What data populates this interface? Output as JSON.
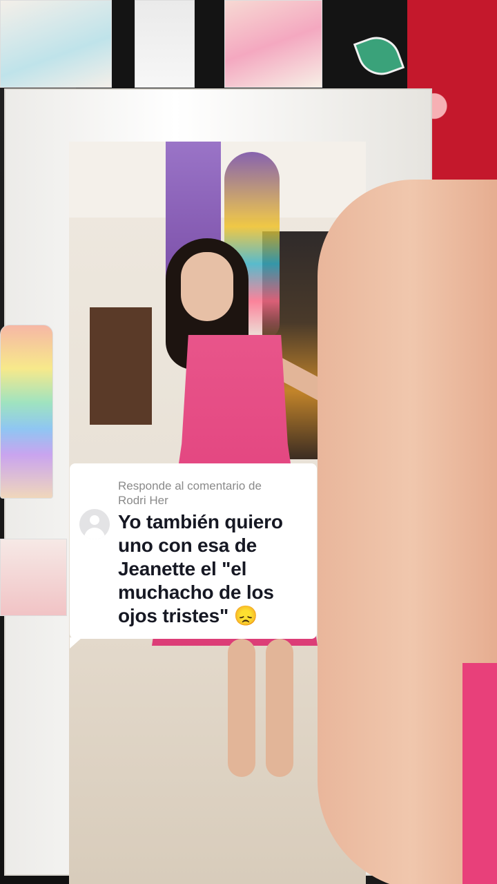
{
  "reply": {
    "header_prefix": "Responde al comentario de",
    "username": "Rodri Her",
    "comment": "Yo también quiero uno con esa de Jeanette el \"el muchacho de los ojos tristes\"",
    "emoji": "😞"
  },
  "icons": {
    "avatar": "default-avatar-icon"
  },
  "colors": {
    "card_background": "#ffffff",
    "header_text": "#8a8a8a",
    "comment_text": "#161823",
    "dress": "#e34580",
    "heart_wall": "#c4182c"
  }
}
